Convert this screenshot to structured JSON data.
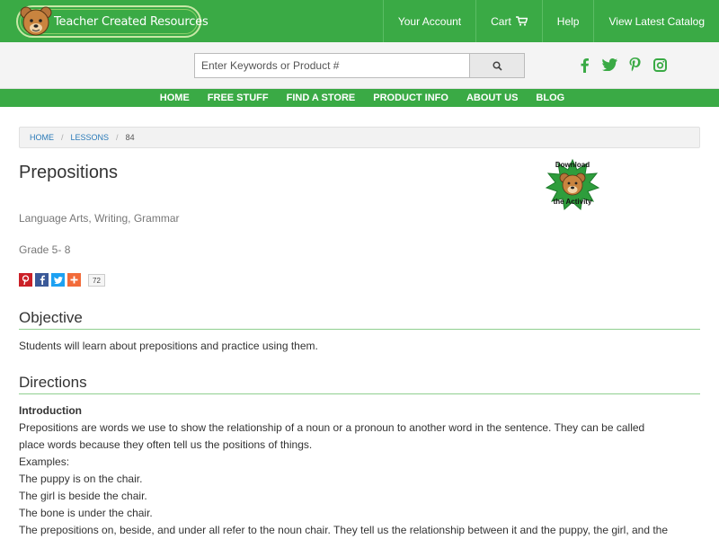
{
  "header": {
    "logo_text": "Teacher Created Resources",
    "nav": [
      "Your Account",
      "Cart",
      "Help",
      "View Latest Catalog"
    ]
  },
  "search": {
    "placeholder": "Enter Keywords or Product #"
  },
  "social_icons": [
    "facebook-icon",
    "twitter-icon",
    "pinterest-icon",
    "instagram-icon"
  ],
  "main_nav": [
    "HOME",
    "FREE STUFF",
    "FIND A STORE",
    "PRODUCT INFO",
    "ABOUT US",
    "BLOG"
  ],
  "breadcrumb": [
    "HOME",
    "LESSONS",
    "84"
  ],
  "lesson": {
    "title": "Prepositions",
    "subjects": "Language Arts, Writing, Grammar",
    "grade": "Grade 5- 8",
    "share_count": "72",
    "download_line1": "Download",
    "download_line2": "the Activity"
  },
  "objective": {
    "heading": "Objective",
    "text": "Students will learn about prepositions and practice using them."
  },
  "directions": {
    "heading": "Directions",
    "intro_heading": "Introduction",
    "lines": [
      "Prepositions are words we use to show the relationship of a noun or a pronoun to another word in the sentence. They can be called",
      "place words because they often tell us the positions of things.",
      "Examples:",
      "The puppy is on the chair.",
      "The girl is beside the chair.",
      "The bone is under the chair.",
      "The prepositions on, beside, and under all refer to the noun chair. They tell us the relationship between it and the puppy, the girl, and the"
    ]
  },
  "colors": {
    "brand_green": "#3aaa45",
    "link_blue": "#2a7ab8",
    "rule_green": "#8fcf8f"
  }
}
